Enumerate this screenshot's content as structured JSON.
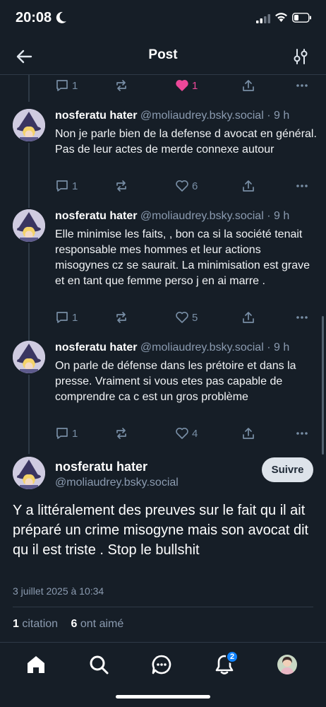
{
  "status_bar": {
    "time": "20:08"
  },
  "header": {
    "title": "Post"
  },
  "top_actions": {
    "reply_count": "1",
    "like_count": "1"
  },
  "replies": [
    {
      "author": "nosferatu hater",
      "handle": "@moliaudrey.bsky.social",
      "time": "· 9 h",
      "text": "Non je parle bien de la defense d avocat en général. Pas de leur actes de merde connexe autour",
      "reply_count": "1",
      "like_count": "6"
    },
    {
      "author": "nosferatu hater",
      "handle": "@moliaudrey.bsky.social",
      "time": "· 9 h",
      "text": "Elle minimise les faits, , bon ca si la société tenait responsable mes hommes et leur actions misogynes cz se saurait. La minimisation est grave et en tant que femme perso j en ai marre .",
      "reply_count": "1",
      "like_count": "5"
    },
    {
      "author": "nosferatu hater",
      "handle": "@moliaudrey.bsky.social",
      "time": "· 9 h",
      "text": "On parle de défense dans les prétoire et dans la presse. Vraiment si vous etes pas capable de comprendre ca c est un gros problème",
      "reply_count": "1",
      "like_count": "4"
    }
  ],
  "main_post": {
    "author": "nosferatu hater",
    "handle": "@moliaudrey.bsky.social",
    "follow_label": "Suivre",
    "text": "Y a littéralement des preuves sur le fait qu il ait préparé un crime misogyne mais son avocat dit qu il est triste . Stop le bullshit",
    "timestamp": "3 juillet 2025 à 10:34",
    "quote_count": "1",
    "quote_label": "citation",
    "like_count": "6",
    "like_label": "ont aimé"
  },
  "tabbar": {
    "notification_count": "2"
  },
  "colors": {
    "background": "#161e27",
    "like_active": "#ec4899",
    "accent": "#1083fe",
    "muted": "#788ea5"
  },
  "icons": [
    "moon-icon",
    "signal-icon",
    "wifi-icon",
    "battery-icon",
    "back-arrow-icon",
    "filter-icon",
    "reply-icon",
    "repost-icon",
    "heart-icon",
    "share-icon",
    "more-icon",
    "home-icon",
    "search-icon",
    "chat-icon",
    "bell-icon",
    "avatar"
  ]
}
